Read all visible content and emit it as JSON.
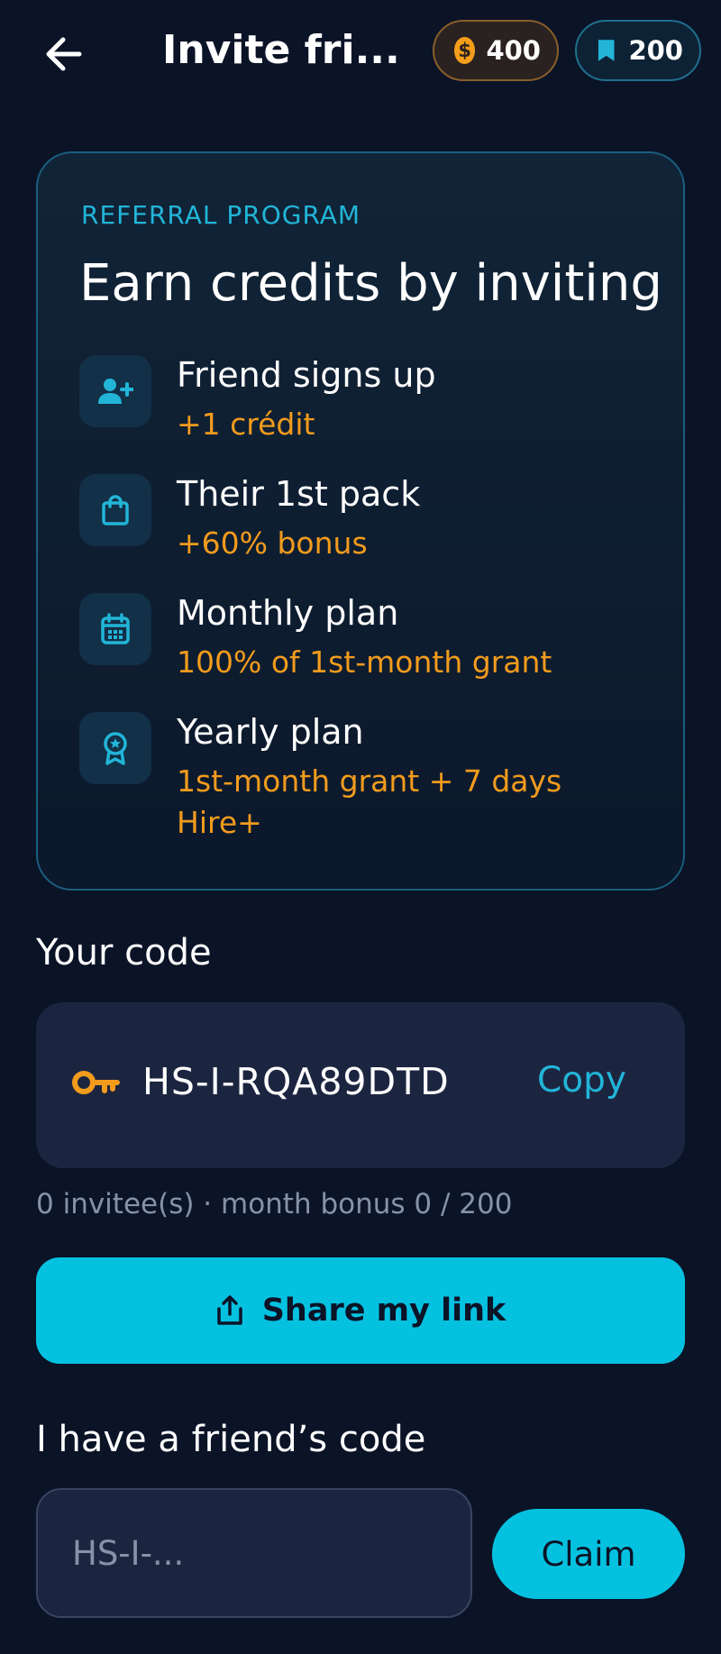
{
  "header": {
    "title": "Invite fri...",
    "coins": "400",
    "bookmarks": "200"
  },
  "referral": {
    "eyebrow": "REFERRAL PROGRAM",
    "title": "Earn credits by inviting",
    "items": [
      {
        "icon": "user-plus-icon",
        "title": "Friend signs up",
        "reward": "+1 crédit"
      },
      {
        "icon": "shopping-bag-icon",
        "title": "Their 1st pack",
        "reward": "+60% bonus"
      },
      {
        "icon": "calendar-icon",
        "title": "Monthly plan",
        "reward": "100% of 1st-month grant"
      },
      {
        "icon": "award-badge-icon",
        "title": "Yearly plan",
        "reward": "1st-month grant + 7 days Hire+"
      }
    ]
  },
  "code_section": {
    "label": "Your code",
    "code": "HS-I-RQA89DTD",
    "copy_label": "Copy",
    "stats": "0 invitee(s) · month bonus 0 / 200"
  },
  "share": {
    "label": "Share my link"
  },
  "friend_code": {
    "label": "I have a friend’s code",
    "placeholder": "HS-I-...",
    "claim_label": "Claim"
  },
  "colors": {
    "background": "#0b1327",
    "accent": "#05c1e0",
    "reward": "#f29b1d",
    "muted": "#8792a8"
  }
}
